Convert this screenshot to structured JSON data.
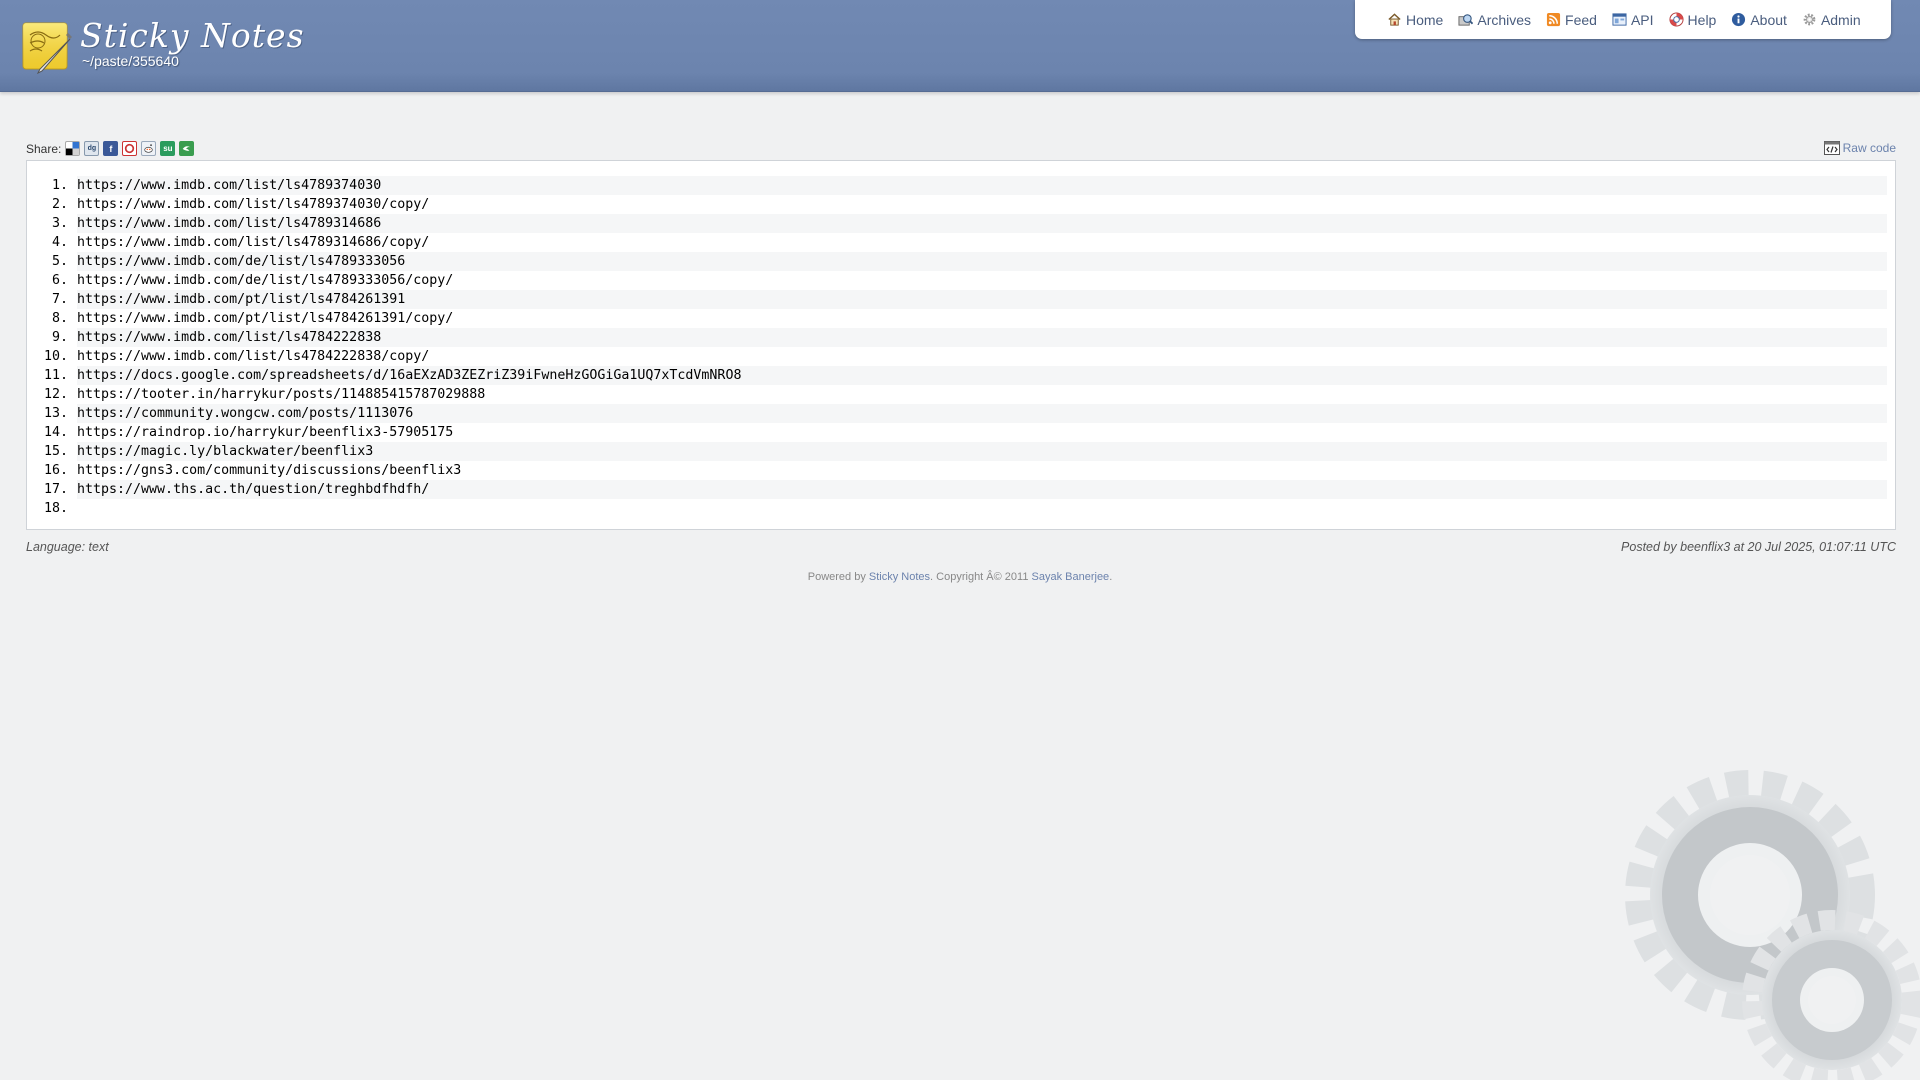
{
  "header": {
    "title": "Sticky Notes",
    "path": "~/paste/355640"
  },
  "nav": {
    "items": [
      {
        "label": "Home",
        "icon": "home-icon"
      },
      {
        "label": "Archives",
        "icon": "archives-icon"
      },
      {
        "label": "Feed",
        "icon": "feed-icon"
      },
      {
        "label": "API",
        "icon": "api-icon"
      },
      {
        "label": "Help",
        "icon": "help-icon"
      },
      {
        "label": "About",
        "icon": "about-icon"
      },
      {
        "label": "Admin",
        "icon": "gear-icon"
      }
    ]
  },
  "share": {
    "label": "Share:",
    "services": [
      "delicious",
      "digg",
      "facebook",
      "technorati",
      "reddit",
      "stumbleupon",
      "twitter"
    ]
  },
  "raw_code": {
    "label": "Raw code"
  },
  "code": {
    "lines": [
      {
        "n": "1.",
        "text": "https://www.imdb.com/list/ls4789374030"
      },
      {
        "n": "2.",
        "text": "https://www.imdb.com/list/ls4789374030/copy/"
      },
      {
        "n": "3.",
        "text": "https://www.imdb.com/list/ls4789314686"
      },
      {
        "n": "4.",
        "text": "https://www.imdb.com/list/ls4789314686/copy/"
      },
      {
        "n": "5.",
        "text": "https://www.imdb.com/de/list/ls4789333056"
      },
      {
        "n": "6.",
        "text": "https://www.imdb.com/de/list/ls4789333056/copy/"
      },
      {
        "n": "7.",
        "text": "https://www.imdb.com/pt/list/ls4784261391"
      },
      {
        "n": "8.",
        "text": "https://www.imdb.com/pt/list/ls4784261391/copy/"
      },
      {
        "n": "9.",
        "text": "https://www.imdb.com/list/ls4784222838"
      },
      {
        "n": "10.",
        "text": "https://www.imdb.com/list/ls4784222838/copy/"
      },
      {
        "n": "11.",
        "text": "https://docs.google.com/spreadsheets/d/16aEXzAD3ZEZriZ39iFwneHzGOGiGa1UQ7xTcdVmNRO8"
      },
      {
        "n": "12.",
        "text": "https://tooter.in/harrykur/posts/114885415787029888"
      },
      {
        "n": "13.",
        "text": "https://community.wongcw.com/posts/1113076"
      },
      {
        "n": "14.",
        "text": "https://raindrop.io/harrykur/beenflix3-57905175"
      },
      {
        "n": "15.",
        "text": "https://magic.ly/blackwater/beenflix3"
      },
      {
        "n": "16.",
        "text": "https://gns3.com/community/discussions/beenflix3"
      },
      {
        "n": "17.",
        "text": "https://www.ths.ac.th/question/treghbdfhdfh/"
      },
      {
        "n": "18.",
        "text": ""
      }
    ]
  },
  "meta": {
    "language": "Language: text",
    "posted": "Posted by beenflix3 at 20 Jul 2025, 01:07:11 UTC"
  },
  "footer": {
    "powered_prefix": "Powered by ",
    "powered_link": "Sticky Notes",
    "copyright": ". Copyright Â© 2011 ",
    "author_link": "Sayak Banerjee",
    "suffix": "."
  }
}
